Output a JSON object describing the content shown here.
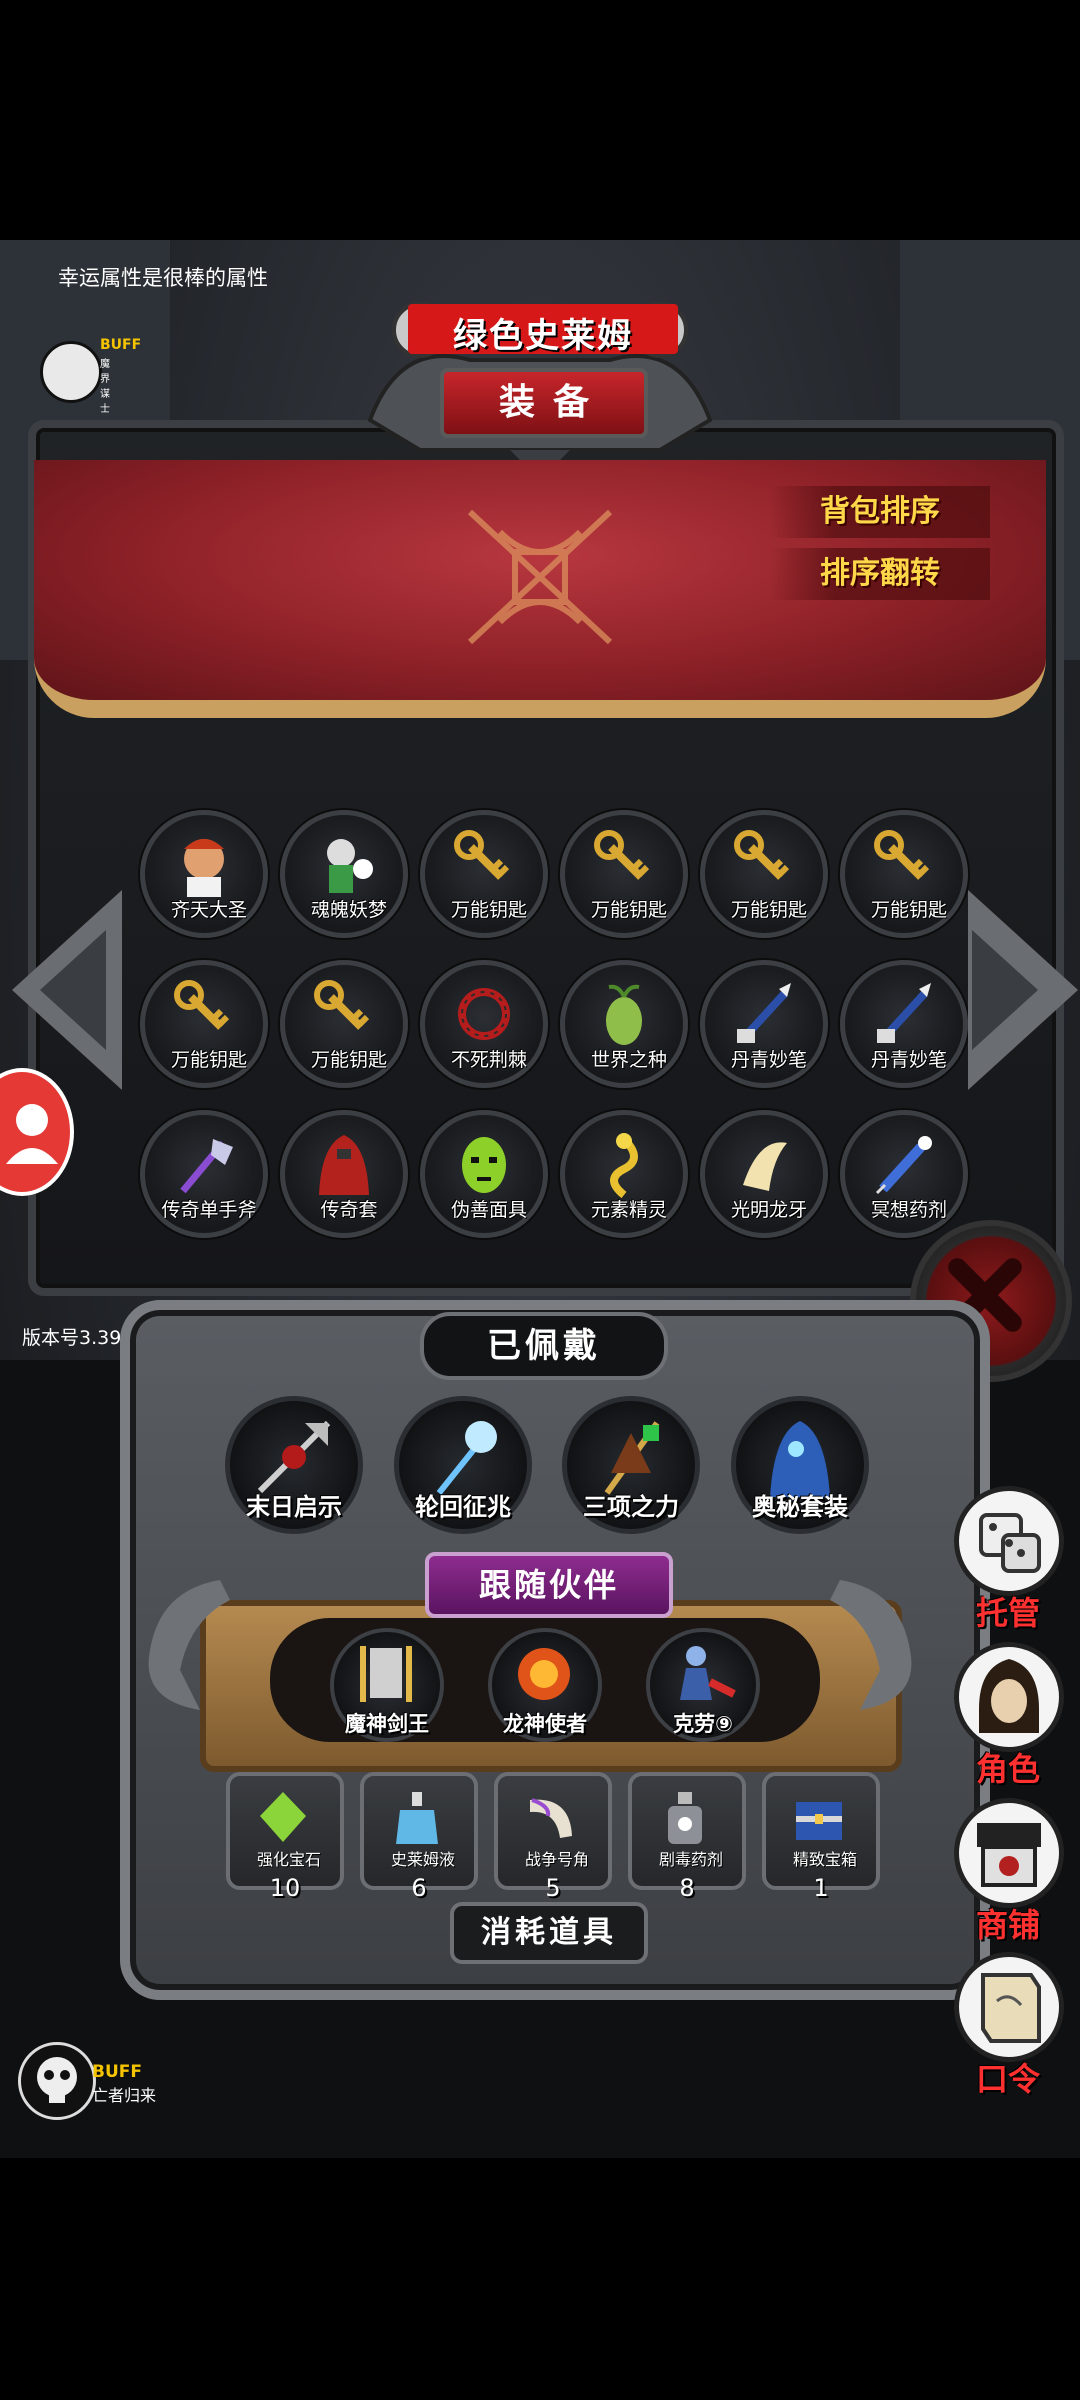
{
  "tip": "幸运属性是很棒的属性",
  "buff_top": {
    "label": "BUFF",
    "sub": "魔界谋士"
  },
  "player_name": "绿色史莱姆",
  "screen_title": "装备",
  "sort_buttons": [
    "背包排序",
    "排序翻转"
  ],
  "backpack_items": [
    {
      "label": "齐天大圣",
      "icon": "monkey-king-icon"
    },
    {
      "label": "魂魄妖梦",
      "icon": "ghost-swordswoman-icon"
    },
    {
      "label": "万能钥匙",
      "icon": "key-icon"
    },
    {
      "label": "万能钥匙",
      "icon": "key-icon"
    },
    {
      "label": "万能钥匙",
      "icon": "key-icon"
    },
    {
      "label": "万能钥匙",
      "icon": "key-icon"
    },
    {
      "label": "万能钥匙",
      "icon": "key-icon"
    },
    {
      "label": "万能钥匙",
      "icon": "key-icon"
    },
    {
      "label": "不死荆棘",
      "icon": "thorn-wreath-icon"
    },
    {
      "label": "世界之种",
      "icon": "seed-icon"
    },
    {
      "label": "丹青妙笔",
      "icon": "brush-icon"
    },
    {
      "label": "丹青妙笔",
      "icon": "brush-icon"
    },
    {
      "label": "传奇单手斧",
      "icon": "axe-icon"
    },
    {
      "label": "传奇套",
      "icon": "robe-icon"
    },
    {
      "label": "伪善面具",
      "icon": "mask-icon"
    },
    {
      "label": "元素精灵",
      "icon": "spirit-icon"
    },
    {
      "label": "光明龙牙",
      "icon": "fang-icon"
    },
    {
      "label": "冥想药剂",
      "icon": "syringe-icon"
    }
  ],
  "version": "版本号3.39",
  "worn_title": "已佩戴",
  "worn_items": [
    {
      "label": "末日启示",
      "icon": "halberd-icon"
    },
    {
      "label": "轮回征兆",
      "icon": "ice-staff-icon"
    },
    {
      "label": "三项之力",
      "icon": "triforce-weapon-icon"
    },
    {
      "label": "奥秘套装",
      "icon": "blue-cloak-icon"
    }
  ],
  "companion_title": "跟随伙伴",
  "companions": [
    {
      "label": "魔神剑王",
      "icon": "sword-king-icon"
    },
    {
      "label": "龙神使者",
      "icon": "dragon-envoy-icon"
    },
    {
      "label": "克劳⑨",
      "icon": "claw-girl-icon"
    }
  ],
  "consumables": [
    {
      "label": "强化宝石",
      "count": "10",
      "icon": "green-gem-icon"
    },
    {
      "label": "史莱姆液",
      "count": "6",
      "icon": "potion-bottle-icon"
    },
    {
      "label": "战争号角",
      "count": "5",
      "icon": "horn-icon"
    },
    {
      "label": "剧毒药剂",
      "count": "8",
      "icon": "poison-bottle-icon"
    },
    {
      "label": "精致宝箱",
      "count": "1",
      "icon": "chest-icon"
    }
  ],
  "consumable_title": "消耗道具",
  "right_menu": [
    {
      "label": "托管",
      "icon": "dice-icon"
    },
    {
      "label": "角色",
      "icon": "hooded-face-icon"
    },
    {
      "label": "商铺",
      "icon": "shop-icon"
    },
    {
      "label": "口令",
      "icon": "scroll-icon"
    }
  ],
  "buff_bottom": {
    "label": "BUFF",
    "sub": "亡者归来"
  },
  "colors": {
    "accent_red": "#d71818",
    "gold": "#ffd84a",
    "command_red": "#ff3030"
  }
}
